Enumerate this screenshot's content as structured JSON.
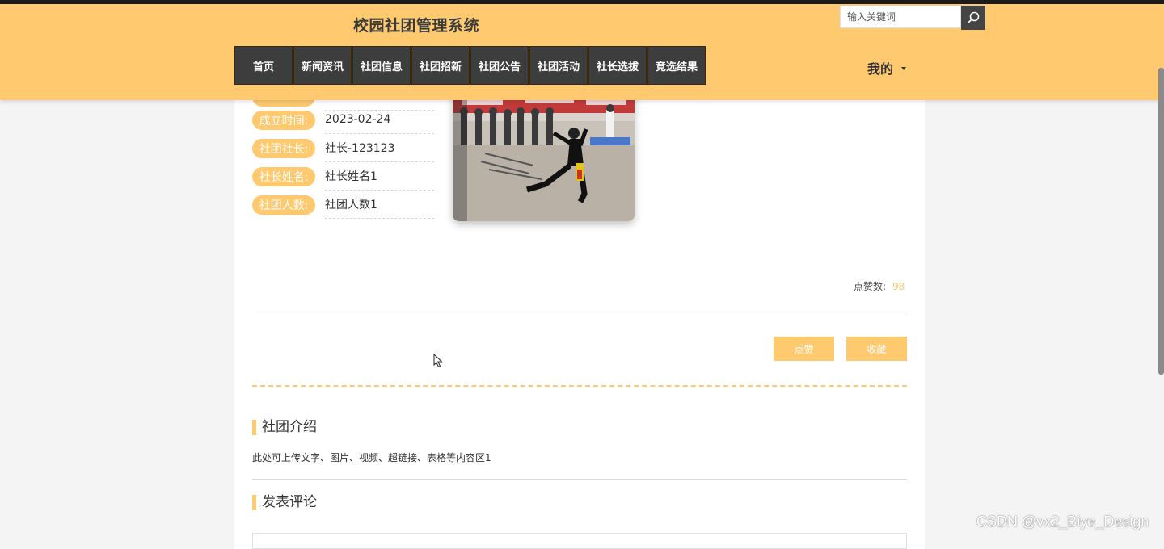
{
  "header": {
    "site_title": "校园社团管理系统",
    "search_placeholder": "输入关键词",
    "nav": [
      "首页",
      "新闻资讯",
      "社团信息",
      "社团招新",
      "社团公告",
      "社团活动",
      "社长选拔",
      "竞选结果"
    ],
    "user_menu": "我的"
  },
  "club_info": [
    {
      "label": "成立时间:",
      "value": "2023-02-24"
    },
    {
      "label": "社团社长:",
      "value": "社长-123123"
    },
    {
      "label": "社长姓名:",
      "value": "社长姓名1"
    },
    {
      "label": "社团人数:",
      "value": "社团人数1"
    }
  ],
  "likes": {
    "label": "点赞数:",
    "count": "98"
  },
  "actions": {
    "like": "点赞",
    "favorite": "收藏"
  },
  "intro": {
    "title": "社团介绍",
    "text": "此处可上传文字、图片、视频、超链接、表格等内容区1"
  },
  "comment": {
    "title": "发表评论"
  },
  "watermark": "CSDN @vx2_Biye_Design",
  "colors": {
    "accent": "#fec96f",
    "nav_bg": "#3d3d3d"
  }
}
